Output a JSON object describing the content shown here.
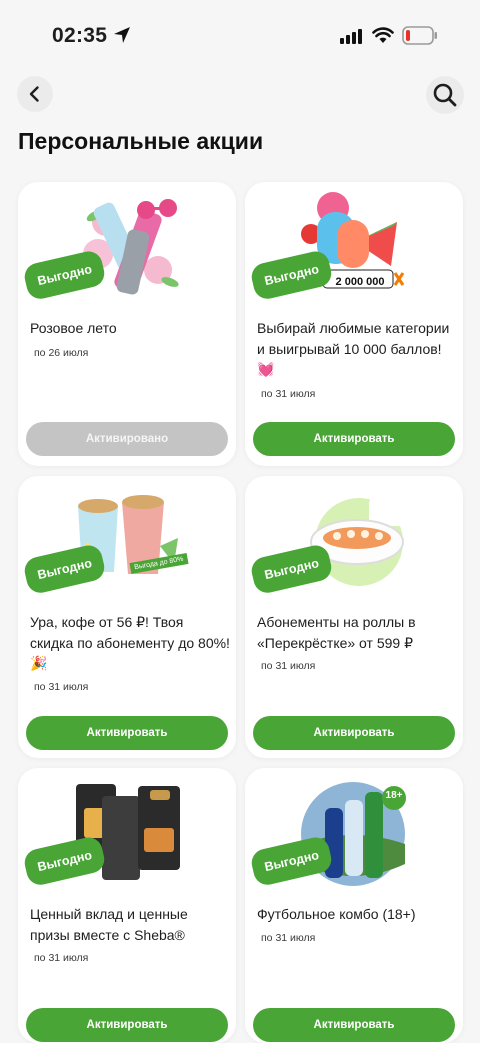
{
  "status_bar": {
    "time": "02:35"
  },
  "header": {
    "title": "Персональные акции"
  },
  "colors": {
    "accent": "#4aa537",
    "disabled": "#c4c4c4",
    "background": "#f6f6f6"
  },
  "offers": [
    {
      "badge": "Выгодно",
      "title": "Розовое лето",
      "date": "по 26 июля",
      "button": "Активировано",
      "state": "activated",
      "image": "pink-drink-cans"
    },
    {
      "badge": "Выгодно",
      "title": "Выбирай любимые категории и выигрывай 10 000 баллов!💓",
      "date": "по 31 июля",
      "button": "Активировать",
      "state": "active",
      "image": "summer-fruit-points",
      "image_tag": "2 000 000"
    },
    {
      "badge": "Выгодно",
      "title": "Ура, кофе от 56 ₽! Твоя скидка по абонементу до 80%! 🎉",
      "date": "по 31 июля",
      "button": "Активировать",
      "state": "active",
      "image": "coffee-cups",
      "image_tag": "Выгода до 80%"
    },
    {
      "badge": "Выгодно",
      "title": "Абонементы на роллы в «Перекрёстке» от 599 ₽",
      "date": "по 31 июля",
      "button": "Активировать",
      "state": "active",
      "image": "sushi-plate"
    },
    {
      "badge": "Выгодно",
      "title": "Ценный вклад и ценные призы вместе с Sheba®",
      "date": "по 31 июля",
      "button": "Активировать",
      "state": "active",
      "image": "sheba-cat-food"
    },
    {
      "badge": "Выгодно",
      "title": "Футбольное комбо (18+)",
      "date": "по 31 июля",
      "button": "Активировать",
      "state": "active",
      "image": "beer-bottles-stadium",
      "image_tag": "18+"
    }
  ]
}
